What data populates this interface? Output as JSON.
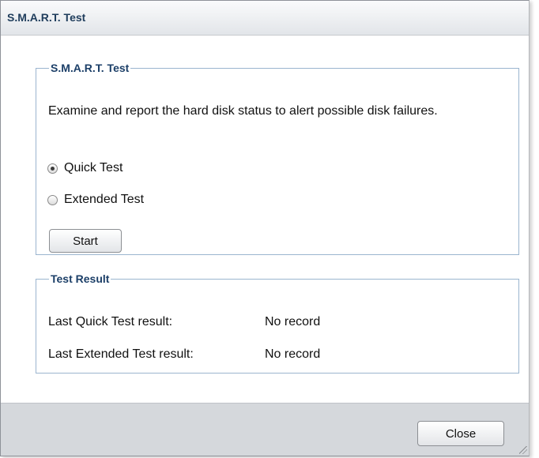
{
  "dialog": {
    "title": "S.M.A.R.T. Test",
    "close_label": "Close"
  },
  "smart_test": {
    "legend": "S.M.A.R.T. Test",
    "description": "Examine and report the hard disk status to alert possible disk failures.",
    "options": [
      {
        "label": "Quick Test",
        "checked": true
      },
      {
        "label": "Extended Test",
        "checked": false
      }
    ],
    "start_label": "Start"
  },
  "test_result": {
    "legend": "Test Result",
    "rows": [
      {
        "label": "Last Quick Test result:",
        "value": "No record"
      },
      {
        "label": "Last Extended Test result:",
        "value": "No record"
      }
    ]
  }
}
